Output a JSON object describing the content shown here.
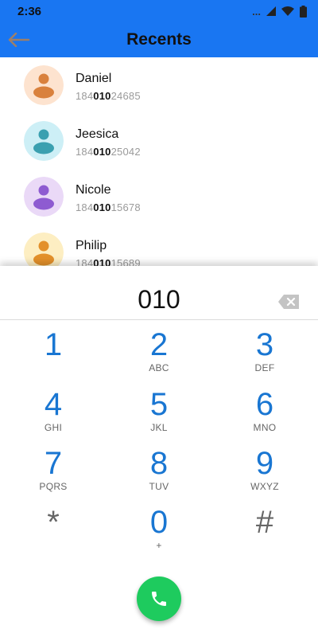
{
  "status_bar": {
    "time": "2:36",
    "dots": "...",
    "accent": "#1976f2"
  },
  "header": {
    "title": "Recents",
    "back_icon": "arrow-back-icon"
  },
  "contacts": [
    {
      "name": "Daniel",
      "number_pre": "184",
      "number_match": "010",
      "number_post": "24685",
      "avatar_bg": "#fde3cf",
      "avatar_fg": "#d9813d"
    },
    {
      "name": "Jeesica",
      "number_pre": "184",
      "number_match": "010",
      "number_post": "25042",
      "avatar_bg": "#cdeff6",
      "avatar_fg": "#3aa0b0"
    },
    {
      "name": "Nicole",
      "number_pre": "184",
      "number_match": "010",
      "number_post": "15678",
      "avatar_bg": "#ead9f7",
      "avatar_fg": "#8e5bd1"
    },
    {
      "name": "Philip",
      "number_pre": "184",
      "number_match": "010",
      "number_post": "15689",
      "avatar_bg": "#fdeec2",
      "avatar_fg": "#e3902a"
    }
  ],
  "dialer": {
    "entry": "010",
    "keys": [
      {
        "digit": "1",
        "letters": ""
      },
      {
        "digit": "2",
        "letters": "ABC"
      },
      {
        "digit": "3",
        "letters": "DEF"
      },
      {
        "digit": "4",
        "letters": "GHI"
      },
      {
        "digit": "5",
        "letters": "JKL"
      },
      {
        "digit": "6",
        "letters": "MNO"
      },
      {
        "digit": "7",
        "letters": "PQRS"
      },
      {
        "digit": "8",
        "letters": "TUV"
      },
      {
        "digit": "9",
        "letters": "WXYZ"
      },
      {
        "digit": "*",
        "letters": ""
      },
      {
        "digit": "0",
        "letters": "+"
      },
      {
        "digit": "#",
        "letters": ""
      }
    ],
    "call_icon": "phone-icon",
    "call_color": "#1ecb5e"
  }
}
